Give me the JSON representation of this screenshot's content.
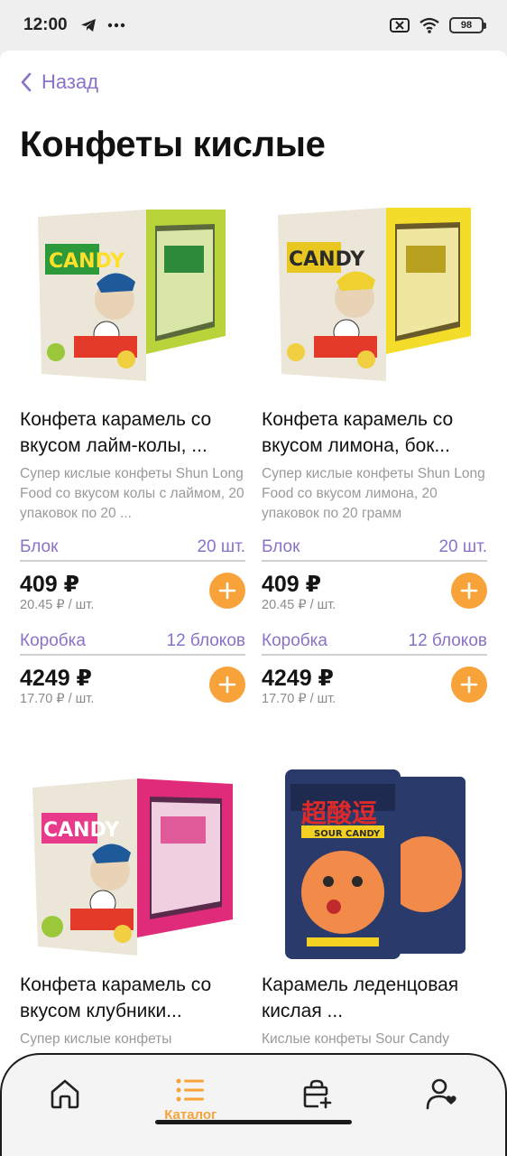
{
  "statusbar": {
    "time": "12:00",
    "battery": "98"
  },
  "header": {
    "back_label": "Назад",
    "title": "Конфеты кислые"
  },
  "products": [
    {
      "name": "Конфета карамель со вкусом лайм-колы, ...",
      "description": "Супер кислые конфеты Shun Long Food со вкусом колы с лаймом, 20 упаковок по 20 ...",
      "image": "green-candy-box",
      "tiers": [
        {
          "label": "Блок",
          "qty": "20 шт.",
          "price": "409 ₽",
          "unit_price": "20.45 ₽ / шт."
        },
        {
          "label": "Коробка",
          "qty": "12 блоков",
          "price": "4249 ₽",
          "unit_price": "17.70 ₽ / шт."
        }
      ]
    },
    {
      "name": "Конфета карамель со вкусом лимона, бок...",
      "description": "Супер кислые конфеты Shun Long Food со вкусом лимона, 20 упаковок по 20 грамм",
      "image": "yellow-candy-box",
      "tiers": [
        {
          "label": "Блок",
          "qty": "20 шт.",
          "price": "409 ₽",
          "unit_price": "20.45 ₽ / шт."
        },
        {
          "label": "Коробка",
          "qty": "12 блоков",
          "price": "4249 ₽",
          "unit_price": "17.70 ₽ / шт."
        }
      ]
    },
    {
      "name": "Конфета карамель со вкусом клубники...",
      "description": "Супер кислые конфеты",
      "image": "pink-candy-box"
    },
    {
      "name": "Карамель леденцовая кислая ...",
      "description": "Кислые конфеты Sour Candy",
      "image": "sour-candy-pack"
    }
  ],
  "bottom_nav": {
    "catalog_label": "Каталог"
  },
  "colors": {
    "accent": "#8a72c8",
    "orange": "#f7a33a"
  }
}
